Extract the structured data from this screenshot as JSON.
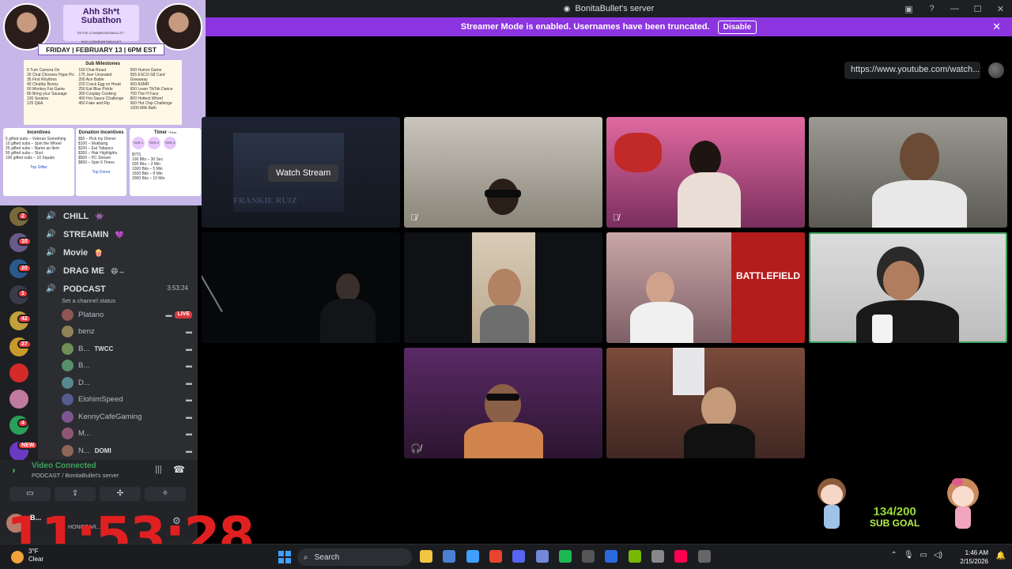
{
  "window": {
    "title": "BonitaBullet's server"
  },
  "banner": {
    "text": "Streamer Mode is enabled. Usernames have been truncated.",
    "disable_label": "Disable",
    "close_glyph": "✕"
  },
  "titlebar_icons": [
    "inbox-icon",
    "help-icon",
    "minimize-icon",
    "maximize-icon",
    "close-icon"
  ],
  "titlebar_glyphs": [
    "▣",
    "?",
    "—",
    "☐",
    "✕"
  ],
  "activity": {
    "url": "https://www.youtube.com/watch..."
  },
  "watch_stream": {
    "button_label": "Watch Stream",
    "poster_title": "FRANKIE RUIZ"
  },
  "overlay": {
    "title_line1": "Ahh Sh*t",
    "title_line2": "Subathon",
    "links": "TIKTOK.COM/@BONITABULLET · KICK.COM/BONITABULLET",
    "date": "FRIDAY | FEBRUARY 13 | 6PM EST",
    "milestones_title": "Sub Milestones",
    "milestones_col1": [
      "5 Turn Camera On",
      "30 Chat Chooses Hype Pic",
      "35 First Rhythms",
      "40 Chubby Bunny",
      "60 Monkey Fat Game",
      "80 Bring your Sausage",
      "100 Seraina",
      "125 Q&A"
    ],
    "milestones_col2": [
      "150 Chat Roast",
      "175 Jeer Unsealed",
      "200 Ace Battle",
      "220 Crack Egg on Head",
      "250 Eat Blue Pickle",
      "300 Cosplay Cooking",
      "400 Hot Sauce Challenge",
      "450 Fake and Rip"
    ],
    "milestones_col3": [
      "500 Humor Game",
      "555 ESCO-S8 Card Giveaway",
      "600 ASMR",
      "650 Learn TikTok Dance",
      "700 The H Face",
      "800 Hottest Wheel",
      "900 Hot Chip Challenge",
      "1000 Milk Bath"
    ],
    "incentives_title": "Incentives",
    "incentives": [
      "5 gifted subs – Veteran Something",
      "10 gifted subs – Spin the Wheel",
      "25 gifted subs – Name an Item",
      "50 gifted subs – Shot",
      "100 gifted subs – 10 Squats"
    ],
    "incentives_footer": "Top Gifter",
    "donation_title": "Donation Incentives",
    "donations": [
      "$50 – Pick my Dinner",
      "$100 – Mukbang",
      "$200 – Eat Tabasco",
      "$300 – Hair Highlights",
      "$500 – PC Stream",
      "$800 – Spin 5 Times"
    ],
    "donation_footer": "Top Donor",
    "timer_title": "Timer",
    "timer_note": "*Tiers",
    "tiers": [
      "TIER 1",
      "TIER 2",
      "TIER 3"
    ],
    "timer_rows": [
      "BITS",
      "100 Bits – 30 Sec",
      "500 Bits – 2 Min",
      "1000 Bits – 5 Min",
      "1500 Bits – 8 Min",
      "2000 Bits – 10 Min"
    ]
  },
  "channels": [
    {
      "name": "CHILL",
      "emoji": "👾"
    },
    {
      "name": "STREAMIN",
      "emoji": "💜"
    },
    {
      "name": "Movie",
      "emoji": "🍿"
    },
    {
      "name": "DRAG ME",
      "emoji": "😄↔"
    },
    {
      "name": "PODCAST",
      "emoji": "",
      "timer": "3:53:24",
      "status": "Set a channel status"
    }
  ],
  "podcast_members": [
    {
      "name": "Platano",
      "live": "LIVE"
    },
    {
      "name": "benz",
      "live": ""
    },
    {
      "name": "B...",
      "tag": "TWCC",
      "live": ""
    },
    {
      "name": "B...",
      "live": ""
    },
    {
      "name": "D...",
      "live": ""
    },
    {
      "name": "ElohimSpeed",
      "live": ""
    },
    {
      "name": "KennyCafeGaming",
      "live": ""
    },
    {
      "name": "M...",
      "live": ""
    },
    {
      "name": "N...",
      "tag": "DOMI",
      "live": ""
    }
  ],
  "server_badges": [
    "2",
    "10",
    "20",
    "1",
    "42",
    "27",
    "4",
    "NEW"
  ],
  "voice": {
    "status": "Video Connected",
    "location": "PODCAST / BonitaBullet's server",
    "buttons": [
      "camera-icon",
      "screen-share-icon",
      "activity-icon",
      "soundboard-icon"
    ],
    "button_glyphs": [
      "▭",
      "⇪",
      "✣",
      "✧"
    ]
  },
  "user": {
    "name": "B...",
    "status": "HONORAR..."
  },
  "stream_timer": "11:53:28",
  "taskbar": {
    "weather_temp": "3°F",
    "weather_cond": "Clear",
    "search_placeholder": "Search",
    "time": "1:46 AM",
    "date": "2/15/2026"
  },
  "subgoal": {
    "count": "134/200",
    "label": "SUB GOAL"
  },
  "colors": {
    "accent": "#8b34e0",
    "speaking": "#3ba55d",
    "live": "#da373c",
    "timer": "#e02020"
  }
}
